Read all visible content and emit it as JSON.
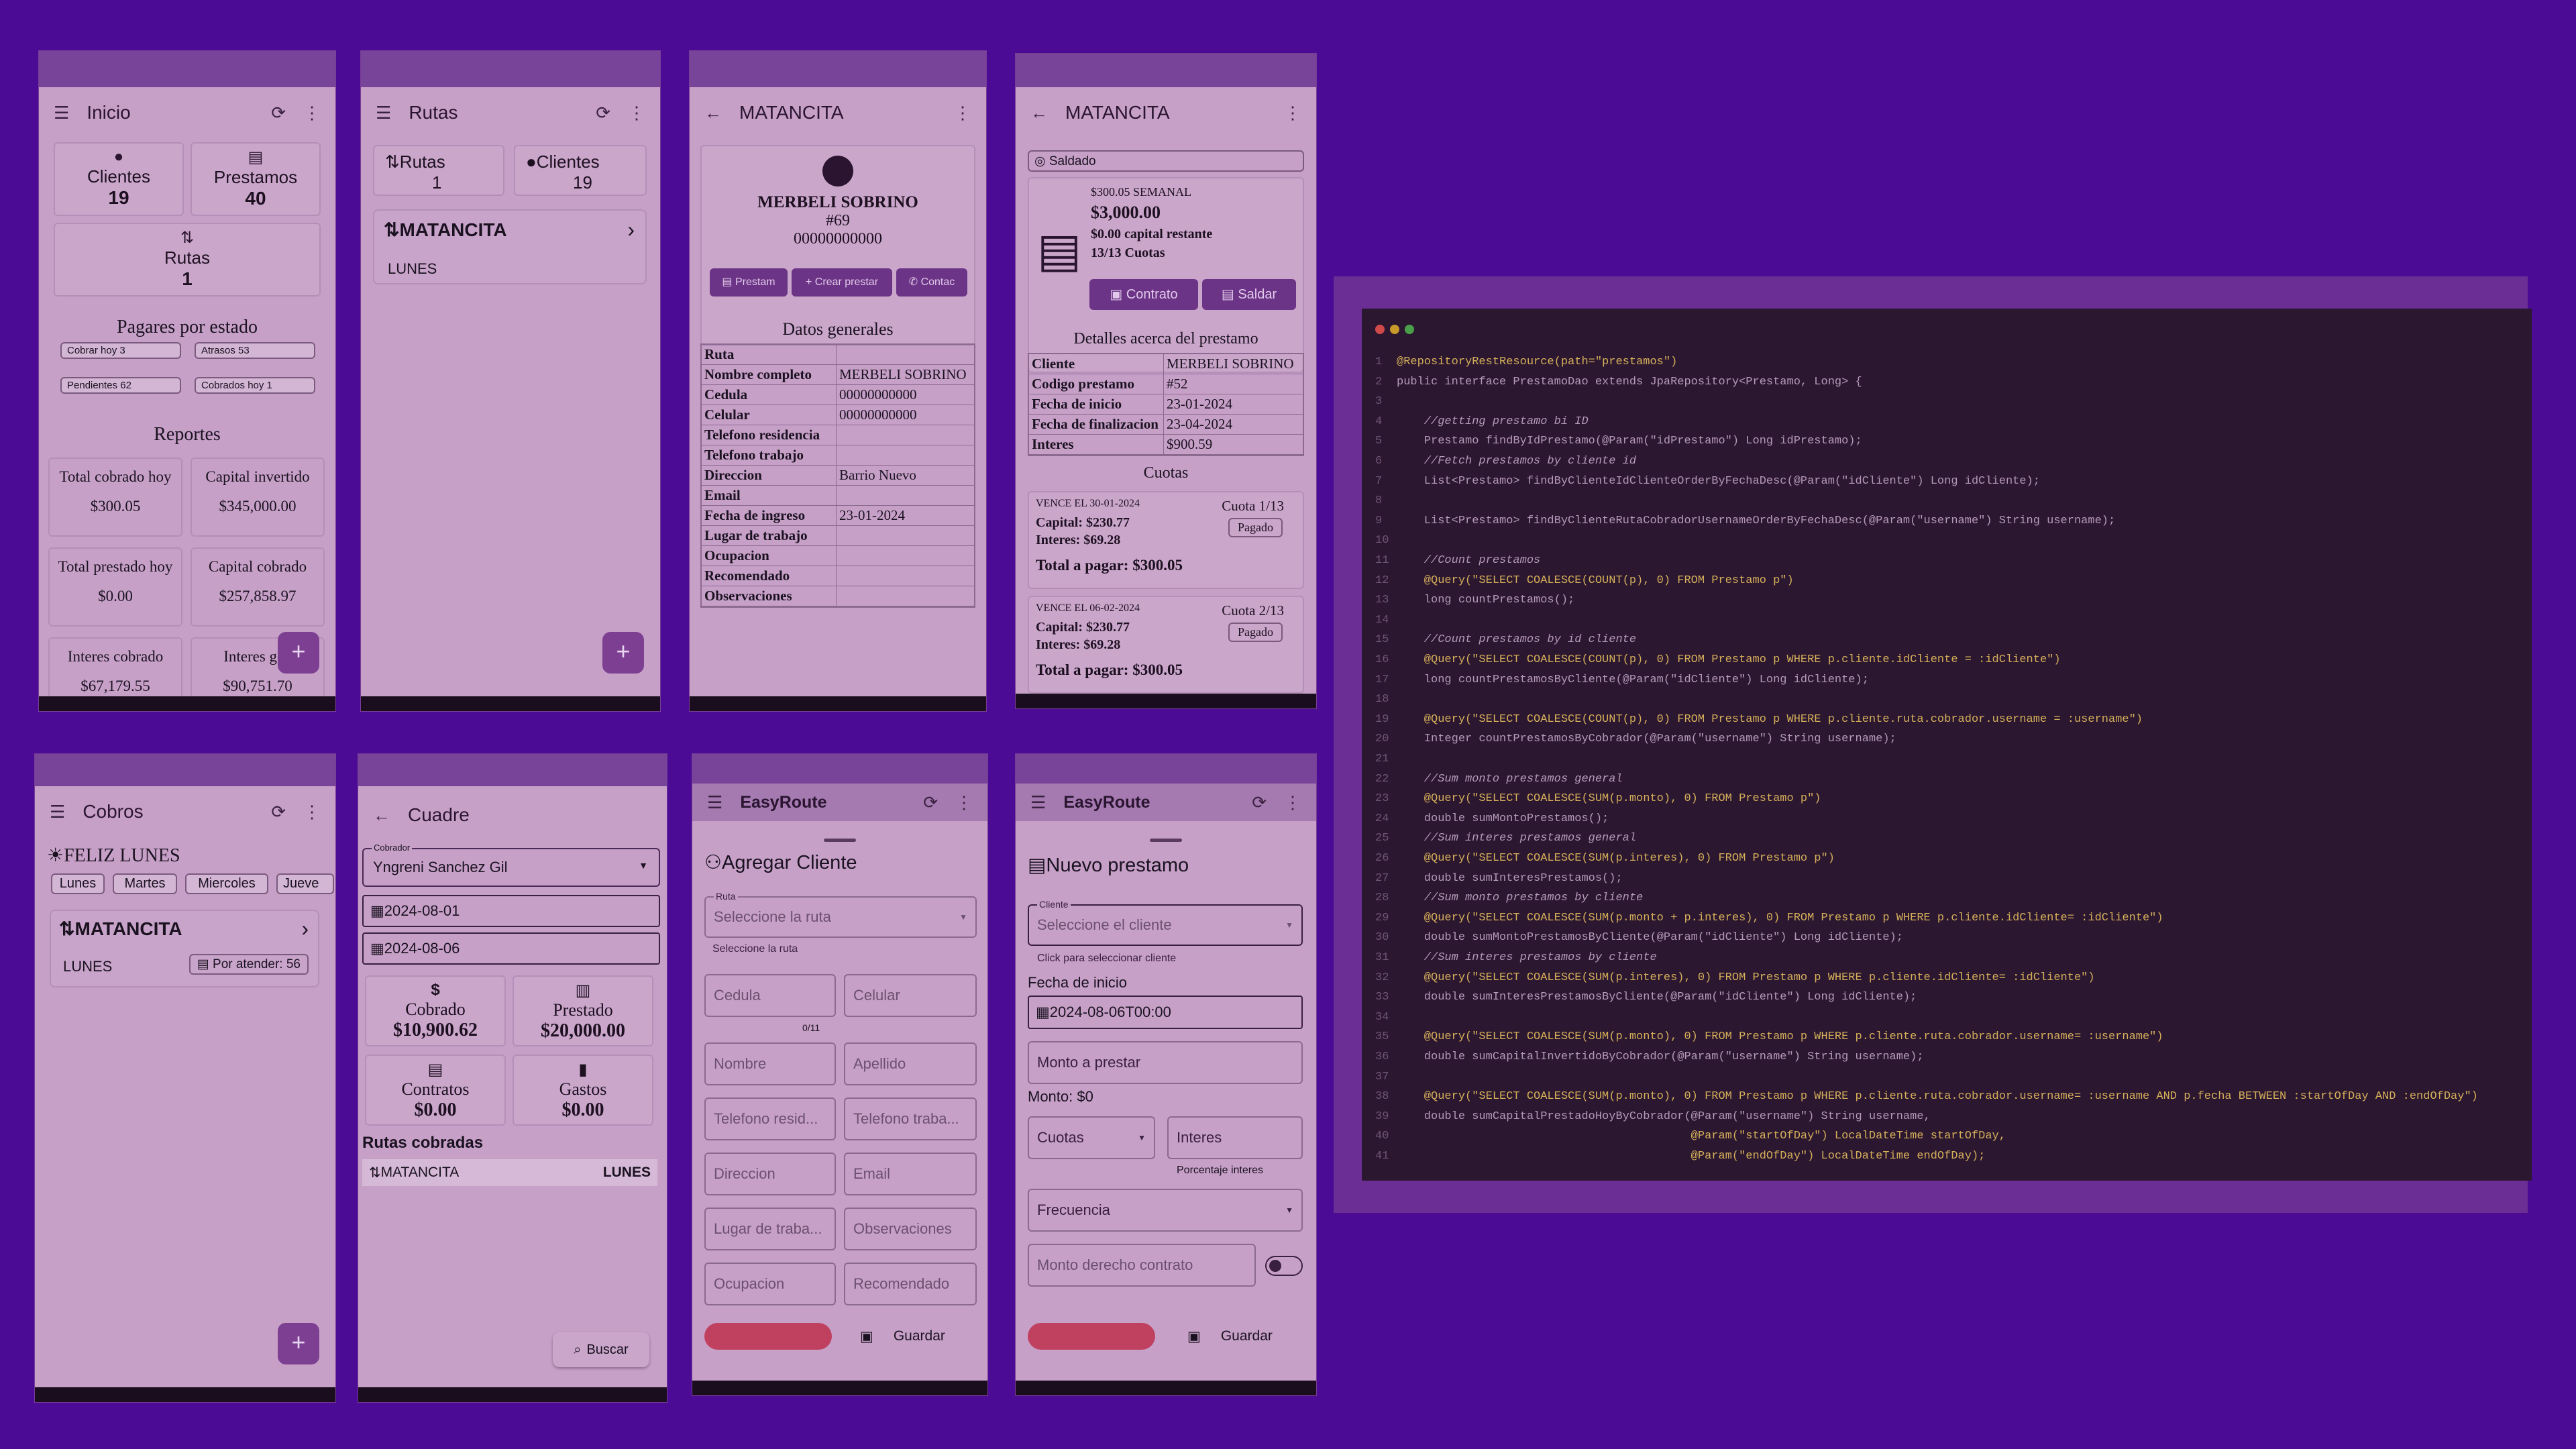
{
  "p1": {
    "title": "Inicio",
    "clientes_label": "Clientes",
    "clientes_val": "19",
    "prestamos_label": "Prestamos",
    "prestamos_val": "40",
    "rutas_label": "Rutas",
    "rutas_val": "1",
    "pagares_title": "Pagares por estado",
    "chips": [
      "Cobrar hoy 3",
      "Atrasos 53",
      "Pendientes 62",
      "Cobrados hoy 1"
    ],
    "reportes_title": "Reportes",
    "reports": [
      {
        "l": "Total cobrado hoy",
        "v": "$300.05"
      },
      {
        "l": "Capital invertido",
        "v": "$345,000.00"
      },
      {
        "l": "Total prestado hoy",
        "v": "$0.00"
      },
      {
        "l": "Capital cobrado",
        "v": "$257,858.97"
      },
      {
        "l": "Interes cobrado",
        "v": "$67,179.55"
      },
      {
        "l": "Interes gen",
        "v": "$90,751.70"
      }
    ]
  },
  "p2": {
    "title": "Rutas",
    "rutas_label": "Rutas",
    "rutas_val": "1",
    "clientes_label": "Clientes",
    "clientes_val": "19",
    "route_name": "MATANCITA",
    "route_day": "LUNES"
  },
  "p3": {
    "title": "MATANCITA",
    "name": "MERBELI SOBRINO",
    "code": "#69",
    "phone": "00000000000",
    "btns": [
      "Prestam",
      "Crear prestar",
      "Contac"
    ],
    "section": "Datos generales",
    "rows": [
      [
        "Ruta",
        ""
      ],
      [
        "Nombre completo",
        "MERBELI SOBRINO"
      ],
      [
        "Cedula",
        "00000000000"
      ],
      [
        "Celular",
        "00000000000"
      ],
      [
        "Telefono residencia",
        ""
      ],
      [
        "Telefono trabajo",
        ""
      ],
      [
        "Direccion",
        "Barrio Nuevo"
      ],
      [
        "Email",
        ""
      ],
      [
        "Fecha de ingreso",
        "23-01-2024"
      ],
      [
        "Lugar de trabajo",
        ""
      ],
      [
        "Ocupacion",
        ""
      ],
      [
        "Recomendado",
        ""
      ],
      [
        "Observaciones",
        ""
      ]
    ]
  },
  "p4": {
    "title": "MATANCITA",
    "saldado": "Saldado",
    "plan": "$300.05 SEMANAL",
    "amount": "$3,000.00",
    "capital": "$0.00 capital restante",
    "cuotas": "13/13 Cuotas",
    "contrato": "Contrato",
    "saldar": "Saldar",
    "section": "Detalles acerca del prestamo",
    "rows": [
      [
        "Cliente",
        "MERBELI SOBRINO"
      ],
      [
        "Codigo prestamo",
        "#52"
      ],
      [
        "Fecha de inicio",
        "23-01-2024"
      ],
      [
        "Fecha de finalizacion",
        "23-04-2024"
      ],
      [
        "Interes",
        "$900.59"
      ]
    ],
    "cuotas_title": "Cuotas",
    "items": [
      {
        "vence": "VENCE EL 30-01-2024",
        "cuota": "Cuota 1/13",
        "capital": "Capital: $230.77",
        "interes": "Interes: $69.28",
        "estado": "Pagado",
        "total": "Total a pagar: $300.05"
      },
      {
        "vence": "VENCE EL 06-02-2024",
        "cuota": "Cuota 2/13",
        "capital": "Capital: $230.77",
        "interes": "Interes: $69.28",
        "estado": "Pagado",
        "total": "Total a pagar: $300.05"
      }
    ]
  },
  "p5": {
    "title": "Cobros",
    "greeting": "FELIZ LUNES",
    "days": [
      "Lunes",
      "Martes",
      "Miercoles",
      "Jueve"
    ],
    "route_name": "MATANCITA",
    "route_day": "LUNES",
    "badge": "Por atender: 56"
  },
  "p6": {
    "title": "Cuadre",
    "cobrador_label": "Cobrador",
    "cobrador": "Yngreni Sanchez Gil",
    "date1": "2024-08-01",
    "date2": "2024-08-06",
    "cards": [
      {
        "l": "Cobrado",
        "v": "$10,900.62"
      },
      {
        "l": "Prestado",
        "v": "$20,000.00"
      },
      {
        "l": "Contratos",
        "v": "$0.00"
      },
      {
        "l": "Gastos",
        "v": "$0.00"
      }
    ],
    "rutas_title": "Rutas cobradas",
    "route": "MATANCITA",
    "route_day": "LUNES",
    "buscar": "Buscar"
  },
  "p7": {
    "app": "EasyRoute",
    "title": "Agregar Cliente",
    "ruta_label": "Ruta",
    "ruta_ph": "Seleccione la ruta",
    "ruta_help": "Seleccione la ruta",
    "counter": "0/11",
    "fields": [
      "Cedula",
      "Celular",
      "Nombre",
      "Apellido",
      "Telefono resid...",
      "Telefono traba...",
      "Direccion",
      "Email",
      "Lugar de traba...",
      "Observaciones",
      "Ocupacion",
      "Recomendado"
    ],
    "guardar": "Guardar"
  },
  "p8": {
    "app": "EasyRoute",
    "title": "Nuevo prestamo",
    "cliente_label": "Cliente",
    "cliente_ph": "Seleccione el cliente",
    "cliente_help": "Click para seleccionar cliente",
    "fecha_label": "Fecha de inicio",
    "fecha": "2024-08-06T00:00",
    "monto_ph": "Monto a prestar",
    "monto_txt": "Monto: $0",
    "cuotas": "Cuotas",
    "interes": "Interes",
    "interes_help": "Porcentaje interes",
    "frecuencia": "Frecuencia",
    "derecho": "Monto derecho contrato",
    "guardar": "Guardar"
  },
  "code": {
    "lines": [
      "@RepositoryRestResource(path=\"prestamos\")",
      "public interface PrestamoDao extends JpaRepository<Prestamo, Long> {",
      "",
      "    //getting prestamo bi ID",
      "    Prestamo findByIdPrestamo(@Param(\"idPrestamo\") Long idPrestamo);",
      "    //Fetch prestamos by cliente id",
      "    List<Prestamo> findByClienteIdClienteOrderByFechaDesc(@Param(\"idCliente\") Long idCliente);",
      "",
      "    List<Prestamo> findByClienteRutaCobradorUsernameOrderByFechaDesc(@Param(\"username\") String username);",
      "",
      "    //Count prestamos",
      "    @Query(\"SELECT COALESCE(COUNT(p), 0) FROM Prestamo p\")",
      "    long countPrestamos();",
      "",
      "    //Count prestamos by id cliente",
      "    @Query(\"SELECT COALESCE(COUNT(p), 0) FROM Prestamo p WHERE p.cliente.idCliente = :idCliente\")",
      "    long countPrestamosByCliente(@Param(\"idCliente\") Long idCliente);",
      "",
      "    @Query(\"SELECT COALESCE(COUNT(p), 0) FROM Prestamo p WHERE p.cliente.ruta.cobrador.username = :username\")",
      "    Integer countPrestamosByCobrador(@Param(\"username\") String username);",
      "",
      "    //Sum monto prestamos general",
      "    @Query(\"SELECT COALESCE(SUM(p.monto), 0) FROM Prestamo p\")",
      "    double sumMontoPrestamos();",
      "    //Sum interes prestamos general",
      "    @Query(\"SELECT COALESCE(SUM(p.interes), 0) FROM Prestamo p\")",
      "    double sumInteresPrestamos();",
      "    //Sum monto prestamos by cliente",
      "    @Query(\"SELECT COALESCE(SUM(p.monto + p.interes), 0) FROM Prestamo p WHERE p.cliente.idCliente= :idCliente\")",
      "    double sumMontoPrestamosByCliente(@Param(\"idCliente\") Long idCliente);",
      "    //Sum interes prestamos by cliente",
      "    @Query(\"SELECT COALESCE(SUM(p.interes), 0) FROM Prestamo p WHERE p.cliente.idCliente= :idCliente\")",
      "    double sumInteresPrestamosByCliente(@Param(\"idCliente\") Long idCliente);",
      "",
      "    @Query(\"SELECT COALESCE(SUM(p.monto), 0) FROM Prestamo p WHERE p.cliente.ruta.cobrador.username= :username\")",
      "    double sumCapitalInvertidoByCobrador(@Param(\"username\") String username);",
      "",
      "    @Query(\"SELECT COALESCE(SUM(p.monto), 0) FROM Prestamo p WHERE p.cliente.ruta.cobrador.username= :username AND p.fecha BETWEEN :startOfDay AND :endOfDay\")",
      "    double sumCapitalPrestadoHoyByCobrador(@Param(\"username\") String username,",
      "                                           @Param(\"startOfDay\") LocalDateTime startOfDay,",
      "                                           @Param(\"endOfDay\") LocalDateTime endOfDay);"
    ]
  },
  "colors": {
    "background": "#4b0b94",
    "phone": "#c7a0c8",
    "statusbar": "#78449a",
    "accent": "#6b3486",
    "code_bg": "#2c1730"
  }
}
